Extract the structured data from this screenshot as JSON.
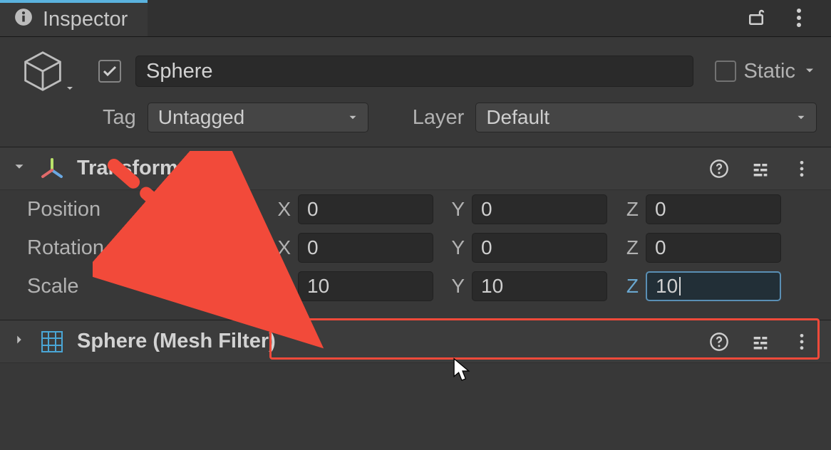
{
  "tabs": {
    "inspector_label": "Inspector"
  },
  "gameObject": {
    "enabled": true,
    "name": "Sphere",
    "static_label": "Static",
    "static_checked": false,
    "tag_label": "Tag",
    "tag_value": "Untagged",
    "layer_label": "Layer",
    "layer_value": "Default"
  },
  "transform": {
    "title": "Transform",
    "rows": {
      "position": {
        "label": "Position",
        "x": "0",
        "y": "0",
        "z": "0"
      },
      "rotation": {
        "label": "Rotation",
        "x": "0",
        "y": "0",
        "z": "0"
      },
      "scale": {
        "label": "Scale",
        "x": "10",
        "y": "10",
        "z": "10"
      }
    },
    "axis_labels": {
      "x": "X",
      "y": "Y",
      "z": "Z"
    }
  },
  "meshFilter": {
    "title": "Sphere (Mesh Filter)"
  },
  "annotation": {
    "highlight": "scale-row",
    "arrow_target": "scale-fields"
  }
}
